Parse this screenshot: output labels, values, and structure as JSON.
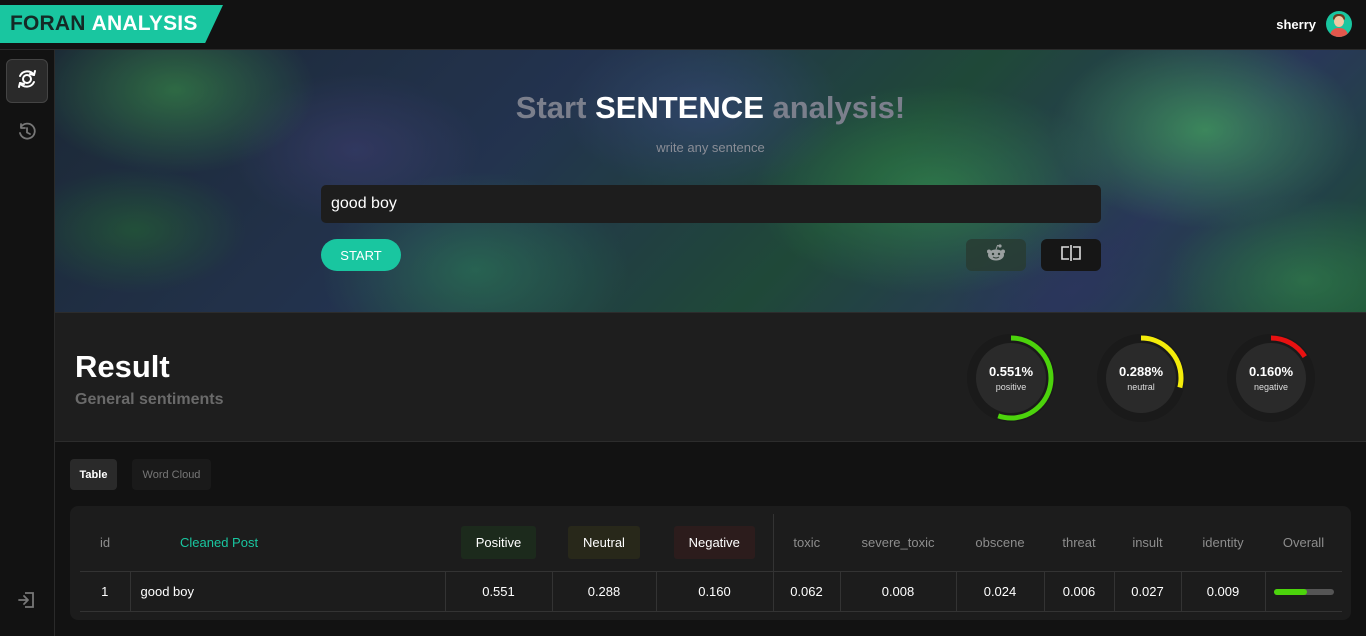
{
  "header": {
    "logo_part1": "FORAN",
    "logo_part2": "ANALYSIS",
    "user_name": "sherry"
  },
  "sidebar": {
    "items": [
      {
        "icon": "analysis-icon",
        "active": true
      },
      {
        "icon": "history-icon",
        "active": false
      },
      {
        "icon": "logout-icon",
        "active": false
      }
    ]
  },
  "hero": {
    "title_start": "Start",
    "title_highlight": "SENTENCE",
    "title_end": "analysis!",
    "subtitle": "write any sentence",
    "input_value": "good boy",
    "start_label": "START",
    "buttons": [
      "reddit-icon",
      "split-icon"
    ]
  },
  "result": {
    "title": "Result",
    "subtitle": "General sentiments",
    "gauges": [
      {
        "value": "0.551%",
        "caption": "positive",
        "fraction": 0.551,
        "color": "#4cd30c"
      },
      {
        "value": "0.288%",
        "caption": "neutral",
        "fraction": 0.288,
        "color": "#f4ec0a"
      },
      {
        "value": "0.160%",
        "caption": "negative",
        "fraction": 0.16,
        "color": "#e81111"
      }
    ]
  },
  "tabs": {
    "table": "Table",
    "word_cloud": "Word Cloud"
  },
  "table": {
    "headers": {
      "id": "id",
      "post": "Cleaned Post",
      "positive": "Positive",
      "neutral": "Neutral",
      "negative": "Negative",
      "toxic": "toxic",
      "severe_toxic": "severe_toxic",
      "obscene": "obscene",
      "threat": "threat",
      "insult": "insult",
      "identity": "identity",
      "overall": "Overall"
    },
    "rows": [
      {
        "id": "1",
        "post": "good boy",
        "positive": "0.551",
        "neutral": "0.288",
        "negative": "0.160",
        "toxic": "0.062",
        "severe_toxic": "0.008",
        "obscene": "0.024",
        "threat": "0.006",
        "insult": "0.027",
        "identity": "0.009",
        "overall_fraction": 0.551
      }
    ]
  },
  "colors": {
    "accent": "#19c6a0",
    "positive": "#4cd30c",
    "neutral": "#f4ec0a",
    "negative": "#e81111"
  }
}
